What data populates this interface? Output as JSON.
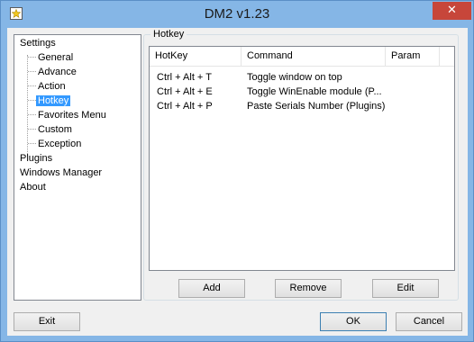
{
  "window": {
    "title": "DM2 v1.23",
    "close_glyph": "✕"
  },
  "tree": {
    "items": [
      {
        "label": "Settings",
        "level": 0
      },
      {
        "label": "General",
        "level": 1
      },
      {
        "label": "Advance",
        "level": 1
      },
      {
        "label": "Action",
        "level": 1
      },
      {
        "label": "Hotkey",
        "level": 1,
        "selected": true
      },
      {
        "label": "Favorites Menu",
        "level": 1
      },
      {
        "label": "Custom",
        "level": 1
      },
      {
        "label": "Exception",
        "level": 1
      },
      {
        "label": "Plugins",
        "level": 0
      },
      {
        "label": "Windows Manager",
        "level": 0
      },
      {
        "label": "About",
        "level": 0
      }
    ]
  },
  "hotkey_panel": {
    "group_title": "Hotkey",
    "columns": [
      "HotKey",
      "Command",
      "Param"
    ],
    "rows": [
      {
        "hotkey": "Ctrl + Alt + T",
        "command": "Toggle window on top",
        "param": ""
      },
      {
        "hotkey": "Ctrl + Alt + E",
        "command": "Toggle WinEnable module (P...",
        "param": ""
      },
      {
        "hotkey": "Ctrl + Alt + P",
        "command": "Paste Serials Number (Plugins)",
        "param": ""
      }
    ],
    "buttons": {
      "add": "Add",
      "remove": "Remove",
      "edit": "Edit"
    }
  },
  "footer": {
    "exit": "Exit",
    "ok": "OK",
    "cancel": "Cancel"
  },
  "colors": {
    "selection": "#3399ff",
    "close_button": "#c7463a",
    "title_bar": "#85b6e6"
  }
}
